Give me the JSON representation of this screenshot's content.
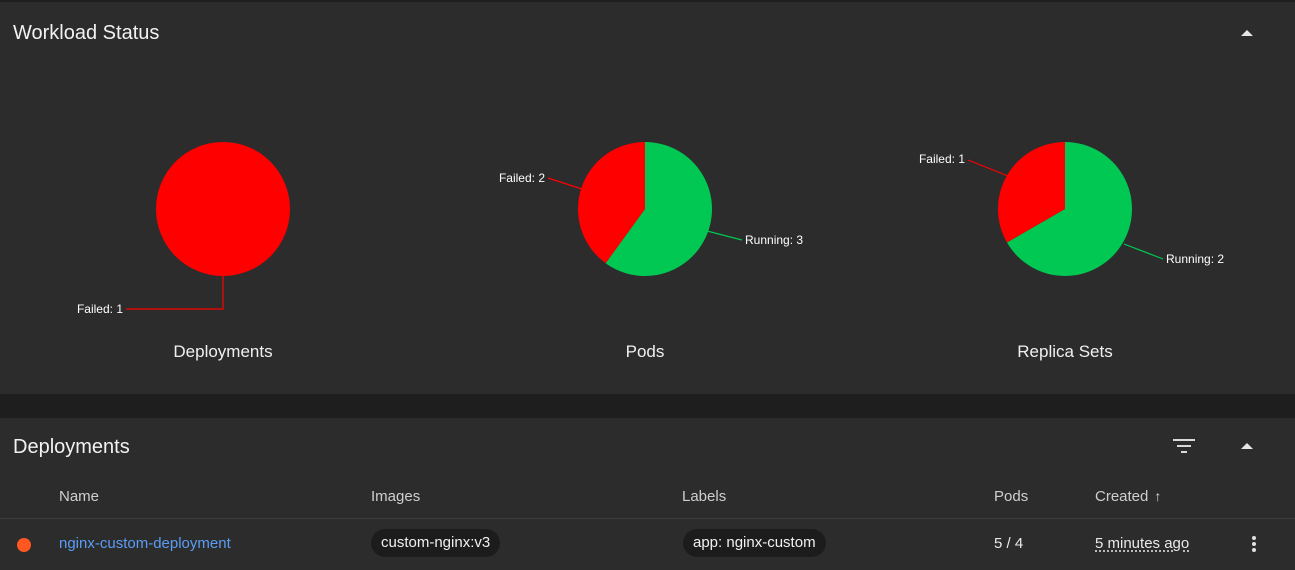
{
  "workload": {
    "title": "Workload Status",
    "charts": [
      {
        "name": "Deployments",
        "failed_label": "Failed: 1",
        "running_label": ""
      },
      {
        "name": "Pods",
        "failed_label": "Failed: 2",
        "running_label": "Running: 3"
      },
      {
        "name": "Replica Sets",
        "failed_label": "Failed: 1",
        "running_label": "Running: 2"
      }
    ]
  },
  "chart_data": [
    {
      "type": "pie",
      "title": "Deployments",
      "slices": [
        {
          "label": "Failed",
          "value": 1,
          "color": "#ff0000"
        }
      ]
    },
    {
      "type": "pie",
      "title": "Pods",
      "slices": [
        {
          "label": "Failed",
          "value": 2,
          "color": "#ff0000"
        },
        {
          "label": "Running",
          "value": 3,
          "color": "#00c853"
        }
      ]
    },
    {
      "type": "pie",
      "title": "Replica Sets",
      "slices": [
        {
          "label": "Failed",
          "value": 1,
          "color": "#ff0000"
        },
        {
          "label": "Running",
          "value": 2,
          "color": "#00c853"
        }
      ]
    }
  ],
  "deployments": {
    "title": "Deployments",
    "columns": {
      "name": "Name",
      "images": "Images",
      "labels": "Labels",
      "pods": "Pods",
      "created": "Created"
    },
    "sort_indicator": "↑",
    "rows": [
      {
        "status_color": "#ff5722",
        "name": "nginx-custom-deployment",
        "image": "custom-nginx:v3",
        "label": "app: nginx-custom",
        "pods": "5 / 4",
        "created": "5 minutes ago"
      }
    ]
  },
  "icons": {
    "collapse": "chevron-up-icon",
    "filter": "filter-icon",
    "menu": "more-vert-icon"
  }
}
